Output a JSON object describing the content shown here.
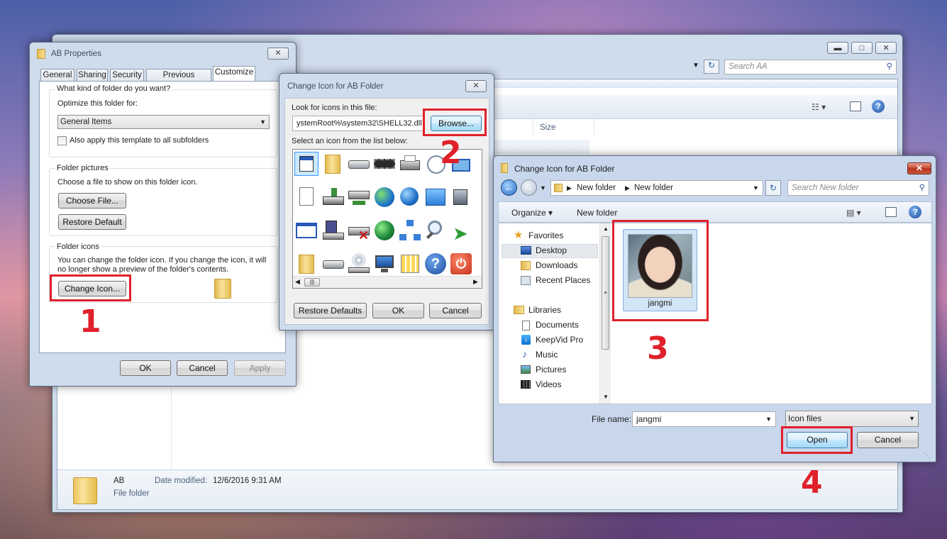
{
  "explorer": {
    "search_placeholder": "Search AA",
    "col_size": "Size",
    "details": {
      "name": "AB",
      "date_label": "Date modified:",
      "date_value": "12/6/2016 9:31 AM",
      "type": "File folder"
    }
  },
  "props": {
    "title": "AB Properties",
    "tabs": [
      "General",
      "Sharing",
      "Security",
      "Previous Versions",
      "Customize"
    ],
    "q_kind": "What kind of folder do you want?",
    "optimize_label": "Optimize this folder for:",
    "optimize_value": "General Items",
    "apply_sub": "Also apply this template to all subfolders",
    "pictures_title": "Folder pictures",
    "pictures_desc": "Choose a file to show on this folder icon.",
    "choose_file": "Choose File...",
    "restore_default": "Restore Default",
    "icons_title": "Folder icons",
    "icons_desc1": "You can change the folder icon. If you change the icon, it will",
    "icons_desc2": "no longer show a preview of the folder's contents.",
    "change_icon": "Change Icon...",
    "ok": "OK",
    "cancel": "Cancel",
    "apply": "Apply"
  },
  "change_icon": {
    "title": "Change Icon for AB Folder",
    "look_label": "Look for icons in this file:",
    "file_path": "ystemRoot%\\system32\\SHELL32.dll",
    "browse": "Browse...",
    "select_label": "Select an icon from the list below:",
    "restore_defaults": "Restore Defaults",
    "ok": "OK",
    "cancel": "Cancel"
  },
  "file_dialog": {
    "title": "Change Icon for AB Folder",
    "breadcrumb": [
      "New folder",
      "New folder"
    ],
    "search_placeholder": "Search New folder",
    "organize": "Organize",
    "new_folder": "New folder",
    "nav": {
      "favorites": "Favorites",
      "desktop": "Desktop",
      "downloads": "Downloads",
      "recent": "Recent Places",
      "libraries": "Libraries",
      "documents": "Documents",
      "keepvid": "KeepVid Pro",
      "music": "Music",
      "pictures": "Pictures",
      "videos": "Videos"
    },
    "file_item": "jangmi",
    "file_name_label": "File name:",
    "file_name_value": "jangmi",
    "file_type": "Icon files",
    "open": "Open",
    "cancel": "Cancel"
  },
  "steps": [
    "1",
    "2",
    "3",
    "4"
  ]
}
